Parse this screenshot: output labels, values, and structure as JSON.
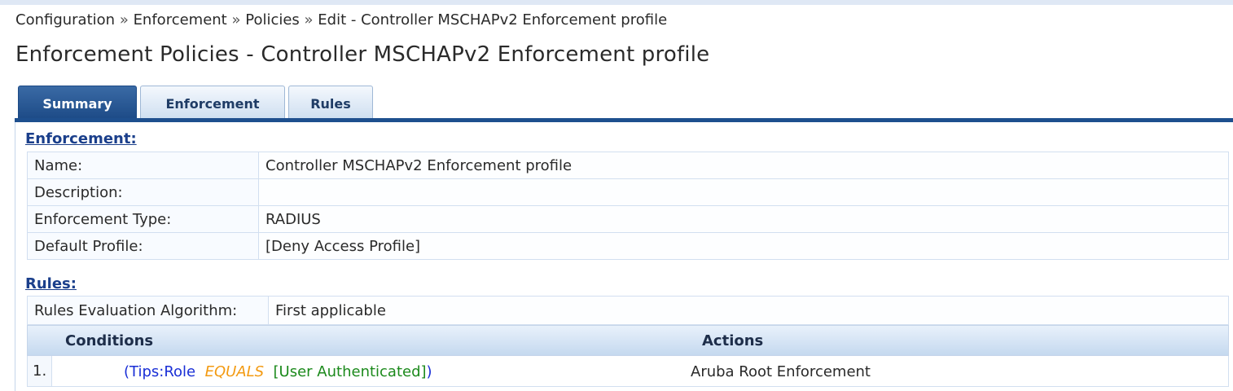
{
  "breadcrumb": {
    "items": [
      "Configuration",
      "Enforcement",
      "Policies",
      "Edit - Controller MSCHAPv2 Enforcement profile"
    ],
    "separator": "»"
  },
  "page_title": "Enforcement Policies - Controller MSCHAPv2 Enforcement profile",
  "tabs": [
    {
      "label": "Summary",
      "active": true
    },
    {
      "label": "Enforcement",
      "active": false
    },
    {
      "label": "Rules",
      "active": false
    }
  ],
  "enforcement": {
    "section_title": "Enforcement:",
    "rows": [
      {
        "label": "Name:",
        "value": "Controller MSCHAPv2 Enforcement profile"
      },
      {
        "label": "Description:",
        "value": ""
      },
      {
        "label": "Enforcement Type:",
        "value": "RADIUS"
      },
      {
        "label": "Default Profile:",
        "value": "[Deny Access Profile]"
      }
    ]
  },
  "rules": {
    "section_title": "Rules:",
    "algorithm_label": "Rules Evaluation Algorithm:",
    "algorithm_value": "First applicable",
    "columns": [
      "Conditions",
      "Actions"
    ],
    "items": [
      {
        "number": "1.",
        "condition": {
          "open": "(",
          "attribute": "Tips:Role",
          "operator": "EQUALS",
          "value": "[User Authenticated]",
          "close": ")"
        },
        "action": "Aruba Root Enforcement"
      }
    ]
  },
  "colors": {
    "tab_active": "#1c4a86",
    "section_link": "#1b3f8b",
    "cond_attribute": "#1a2fd6",
    "cond_operator": "#f39a11",
    "cond_value": "#1c8a1c"
  }
}
